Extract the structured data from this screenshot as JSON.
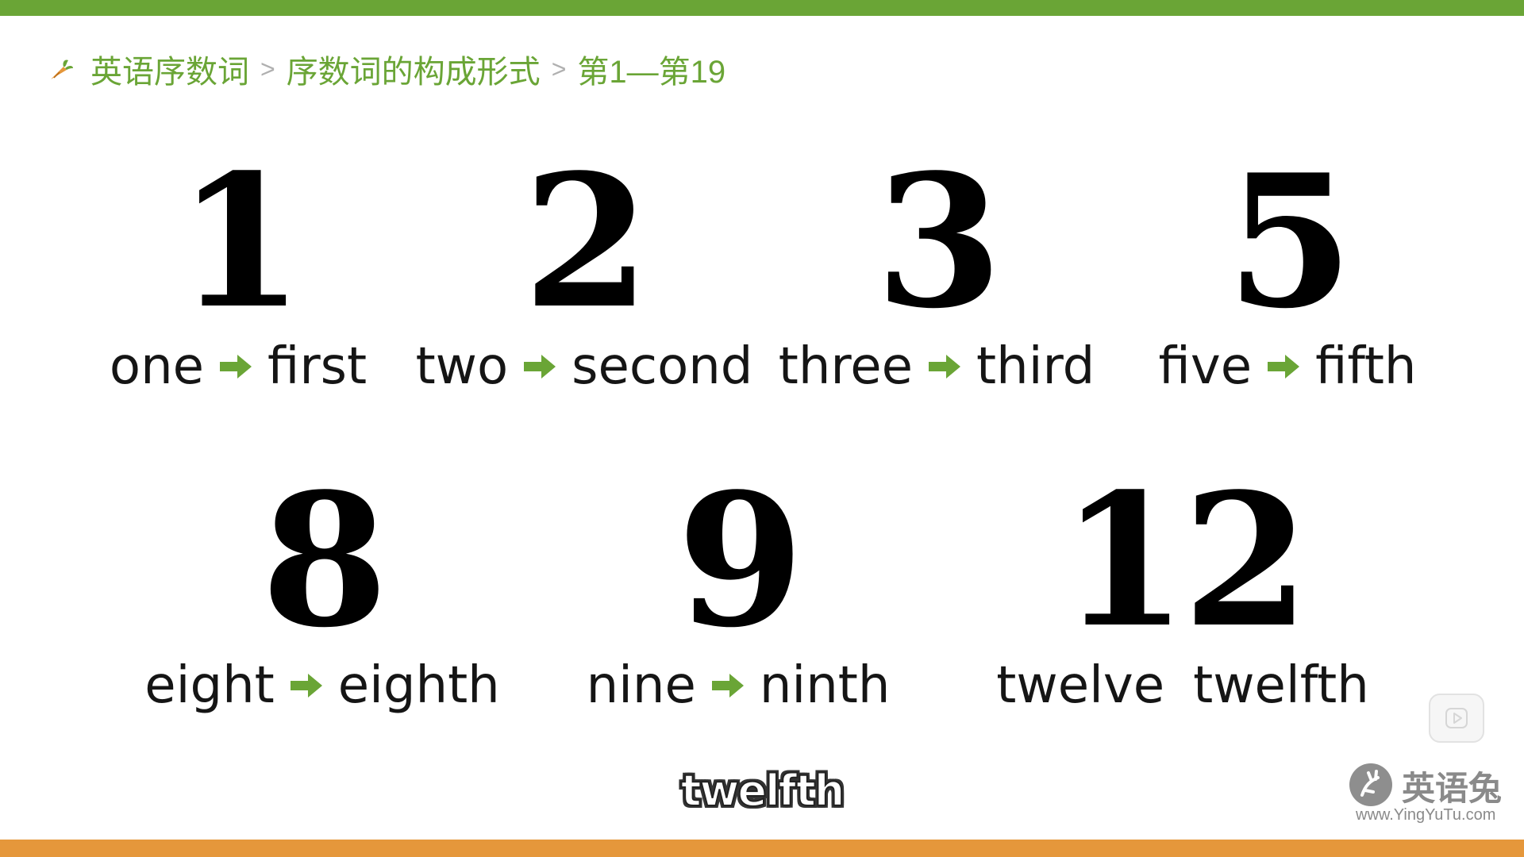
{
  "breadcrumb": {
    "items": [
      "英语序数词",
      "序数词的构成形式",
      "第1—第19"
    ],
    "separator": ">"
  },
  "colors": {
    "accent_green": "#6aa536",
    "bottom_orange": "#e5973b",
    "numeral": "#000000"
  },
  "cards": [
    {
      "numeral": "1",
      "cardinal": "one",
      "ordinal": "first"
    },
    {
      "numeral": "2",
      "cardinal": "two",
      "ordinal": "second"
    },
    {
      "numeral": "3",
      "cardinal": "three",
      "ordinal": "third"
    },
    {
      "numeral": "5",
      "cardinal": "five",
      "ordinal": "fifth"
    },
    {
      "numeral": "8",
      "cardinal": "eight",
      "ordinal": "eighth"
    },
    {
      "numeral": "9",
      "cardinal": "nine",
      "ordinal": "ninth"
    },
    {
      "numeral": "12",
      "cardinal": "twelve",
      "ordinal": "twelfth"
    }
  ],
  "subtitle": "twelfth",
  "watermark": {
    "name": "英语兔",
    "url": "www.YingYuTu.com"
  },
  "icons": {
    "breadcrumb": "carrot-icon",
    "transform": "right-arrow-icon",
    "video": "play-icon"
  }
}
